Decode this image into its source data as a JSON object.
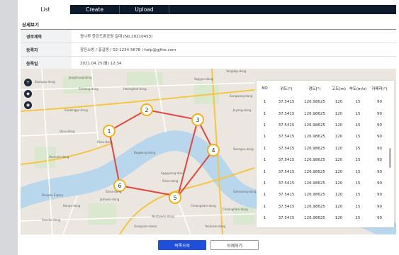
{
  "tabs": [
    {
      "label": "List"
    },
    {
      "label": "Create"
    },
    {
      "label": "Upload"
    }
  ],
  "section_title": "상세보기",
  "info": [
    {
      "key": "경로제목",
      "value": "광나루 한강드론공원 일대 (No.20210453)"
    },
    {
      "key": "등록자",
      "value": "광진소방 / 홍길동 / 02-1234-5678 / help@gjfire.com"
    },
    {
      "key": "등록일",
      "value": "2021.04.25(월) 12:34"
    }
  ],
  "map": {
    "route_color": "#e0473e",
    "marker_color": "#f2b21b",
    "river_color": "#b8d6ec",
    "waypoints": [
      "1",
      "2",
      "3",
      "4",
      "5",
      "6"
    ],
    "labels": [
      "Jangchung-dong",
      "Seongsu-dong",
      "Sagyun-dong",
      "Yongdap-dong",
      "Sindang-dong",
      "Hwanghak-dong",
      "Sangwang-dong",
      "Seongsu-dong",
      "Hannam-dong",
      "Oksu-dong",
      "Sinsa-dong",
      "Apgujeong-dong",
      "Cheongdam-dong",
      "Samseong-dong",
      "Banpo-dong",
      "Jamwon-dong",
      "Dongbu Expwy",
      "Oksu-dong",
      "Bogwang-dong",
      "Seobinggo-dong",
      "Seocho-dong",
      "Gangnam-daero",
      "Sinsa-dong",
      "Nonhyeon-dong",
      "Yeoksam-dong",
      "Jayang-dong",
      "Cheongdam-dong"
    ]
  },
  "point_table": {
    "headers": [
      "NO",
      "위도(°)",
      "경도(°)",
      "고도(m)",
      "속도(m/s)",
      "카메라(°)"
    ],
    "rows": [
      [
        "1",
        "37.5415",
        "126.98625",
        "120",
        "15",
        "90"
      ],
      [
        "1",
        "37.5415",
        "126.98625",
        "120",
        "15",
        "90"
      ],
      [
        "1",
        "37.5415",
        "126.98625",
        "120",
        "15",
        "90"
      ],
      [
        "1",
        "37.5415",
        "126.98625",
        "120",
        "15",
        "90"
      ],
      [
        "1",
        "37.5415",
        "126.98625",
        "120",
        "15",
        "90"
      ],
      [
        "1",
        "37.5415",
        "126.98625",
        "120",
        "15",
        "90"
      ],
      [
        "1",
        "37.5415",
        "126.98625",
        "120",
        "15",
        "90"
      ],
      [
        "1",
        "37.5415",
        "126.98625",
        "120",
        "15",
        "90"
      ],
      [
        "1",
        "37.5415",
        "126.98625",
        "120",
        "15",
        "90"
      ],
      [
        "1",
        "37.5415",
        "126.98625",
        "120",
        "15",
        "90"
      ],
      [
        "1",
        "37.5415",
        "126.98625",
        "120",
        "15",
        "90"
      ]
    ]
  },
  "buttons": {
    "list": "목록으로",
    "delete": "삭제하기"
  }
}
